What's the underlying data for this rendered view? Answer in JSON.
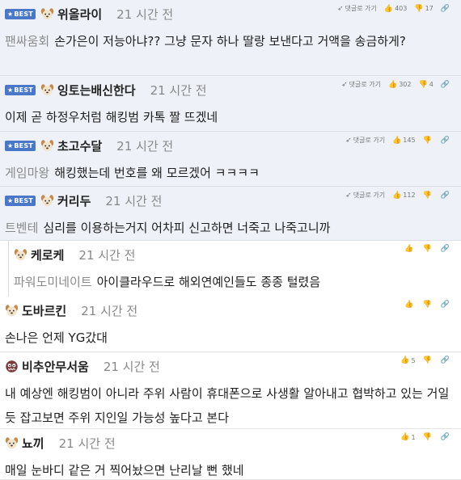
{
  "icons": {
    "reply_link": "pencil-arrow-icon",
    "upvote": "thumbs-up-icon",
    "downvote": "thumbs-down-icon",
    "more": "link-icon"
  },
  "colors": {
    "best_badge": "#4a78c8",
    "best_bg": "#eef2f8",
    "tag_text": "#8a8a8a",
    "time_text": "#888888"
  },
  "comments": [
    {
      "kind": "best",
      "badge": "BEST",
      "nickname": "위올라이",
      "time": "21 시간 전",
      "tag": "팬싸움회",
      "text": "손가은이 저능아냐?? 그냥 문자 하나 딸랑 보낸다고 거액을 송금하게?",
      "reply_link": "댓글로 가기",
      "upvotes": "403",
      "downvotes": "17",
      "avatar": "dog-avatar"
    },
    {
      "kind": "best",
      "badge": "BEST",
      "nickname": "잉토는배신한다",
      "time": "21 시간 전",
      "tag": "",
      "text": "이제 곧 하정우처럼 해킹범 카톡 짤 뜨겠네",
      "reply_link": "댓글로 가기",
      "upvotes": "302",
      "downvotes": "4",
      "avatar": "dog-avatar"
    },
    {
      "kind": "best",
      "badge": "BEST",
      "nickname": "초고수달",
      "time": "21 시간 전",
      "tag": "게임마왕",
      "text": "해킹했는데 번호를 왜 모르겠어 ㅋㅋㅋㅋ",
      "reply_link": "댓글로 가기",
      "upvotes": "145",
      "downvotes": "",
      "avatar": "dog-avatar"
    },
    {
      "kind": "best",
      "badge": "BEST",
      "nickname": "커리두",
      "time": "21 시간 전",
      "tag": "트벤테",
      "text": "심리를 이용하는거지 어차피 신고하면 너죽고 나죽고니까",
      "reply_link": "댓글로 가기",
      "upvotes": "112",
      "downvotes": "",
      "avatar": "dog-avatar"
    },
    {
      "kind": "reply",
      "badge": "",
      "nickname": "케로케",
      "time": "21 시간 전",
      "tag": "파워도미네이트",
      "text": "아이클라우드로 해외연예인들도 종종 털렸음",
      "reply_link": "",
      "upvotes": "",
      "downvotes": "",
      "avatar": "dog-avatar"
    },
    {
      "kind": "normal",
      "badge": "",
      "nickname": "도바르킨",
      "time": "21 시간 전",
      "tag": "",
      "text": "손나은 언제 YG갔대",
      "reply_link": "",
      "upvotes": "",
      "downvotes": "",
      "avatar": "dog-avatar"
    },
    {
      "kind": "normal",
      "badge": "",
      "nickname": "비추안무서움",
      "time": "21 시간 전",
      "tag": "",
      "text": "내 예상엔 해킹범이 아니라 주위 사람이 휴대폰으로 사생활 알아내고 협박하고 있는 거일 듯 잡고보면 주위 지인일 가능성 높다고 본다",
      "reply_link": "",
      "upvotes": "5",
      "downvotes": "",
      "avatar": "monster-avatar"
    },
    {
      "kind": "normal",
      "badge": "",
      "nickname": "뇨끼",
      "time": "21 시간 전",
      "tag": "",
      "text": "매일 눈바디 같은 거 찍어놨으면 난리날 뻔 했네",
      "reply_link": "",
      "upvotes": "1",
      "downvotes": "",
      "avatar": "dog-avatar"
    }
  ]
}
